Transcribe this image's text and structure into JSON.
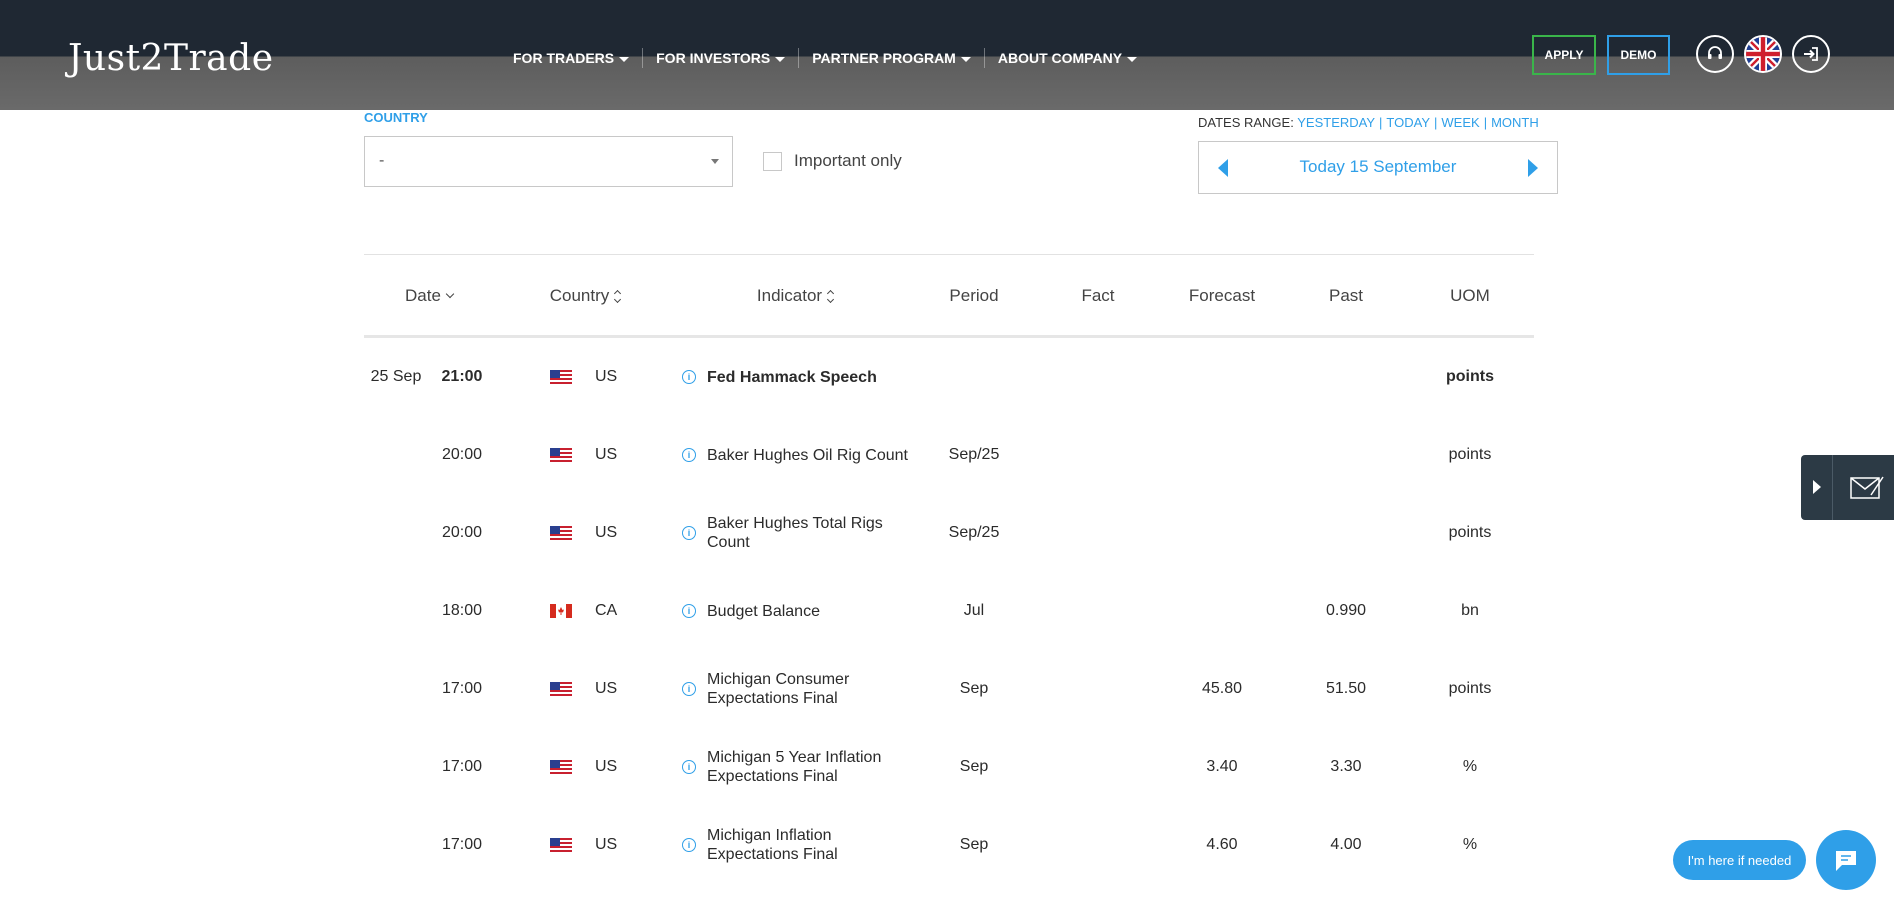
{
  "header": {
    "logo": "Just2Trade",
    "nav": [
      {
        "label": "FOR TRADERS"
      },
      {
        "label": "FOR INVESTORS"
      },
      {
        "label": "PARTNER PROGRAM"
      },
      {
        "label": "ABOUT COMPANY"
      }
    ],
    "apply_label": "APPLY",
    "demo_label": "DEMO",
    "icons": [
      "headset-icon",
      "uk-flag-icon",
      "login-icon"
    ]
  },
  "filters": {
    "country_label": "COUNTRY",
    "country_value": "-",
    "important_label": "Important only",
    "dates_range_label": "DATES RANGE:",
    "ranges": [
      "YESTERDAY",
      "TODAY",
      "WEEK",
      "MONTH"
    ],
    "current_date": "Today 15 September"
  },
  "table": {
    "headers": {
      "date": "Date",
      "country": "Country",
      "indicator": "Indicator",
      "period": "Period",
      "fact": "Fact",
      "forecast": "Forecast",
      "past": "Past",
      "uom": "UOM"
    },
    "rows": [
      {
        "day": "25 Sep",
        "time": "21:00",
        "flag": "us",
        "country": "US",
        "indicator": "Fed Hammack Speech",
        "period": "",
        "fact": "",
        "forecast": "",
        "past": "",
        "uom": "points",
        "bold": true
      },
      {
        "day": "",
        "time": "20:00",
        "flag": "us",
        "country": "US",
        "indicator": "Baker Hughes Oil Rig Count",
        "period": "Sep/25",
        "fact": "",
        "forecast": "",
        "past": "",
        "uom": "points",
        "bold": false
      },
      {
        "day": "",
        "time": "20:00",
        "flag": "us",
        "country": "US",
        "indicator": "Baker Hughes Total Rigs Count",
        "period": "Sep/25",
        "fact": "",
        "forecast": "",
        "past": "",
        "uom": "points",
        "bold": false
      },
      {
        "day": "",
        "time": "18:00",
        "flag": "ca",
        "country": "CA",
        "indicator": "Budget Balance",
        "period": "Jul",
        "fact": "",
        "forecast": "",
        "past": "0.990",
        "uom": "bn",
        "bold": false
      },
      {
        "day": "",
        "time": "17:00",
        "flag": "us",
        "country": "US",
        "indicator": "Michigan Consumer Expectations Final",
        "period": "Sep",
        "fact": "",
        "forecast": "45.80",
        "past": "51.50",
        "uom": "points",
        "bold": false
      },
      {
        "day": "",
        "time": "17:00",
        "flag": "us",
        "country": "US",
        "indicator": "Michigan 5 Year Inflation Expectations Final",
        "period": "Sep",
        "fact": "",
        "forecast": "3.40",
        "past": "3.30",
        "uom": "%",
        "bold": false
      },
      {
        "day": "",
        "time": "17:00",
        "flag": "us",
        "country": "US",
        "indicator": "Michigan Inflation Expectations Final",
        "period": "Sep",
        "fact": "",
        "forecast": "4.60",
        "past": "4.00",
        "uom": "%",
        "bold": false
      }
    ]
  },
  "chat": {
    "bubble_text": "I'm here if needed"
  },
  "colors": {
    "accent": "#2f9fe8",
    "apply_border": "#3ab54a",
    "header_dark": "#1f2833"
  }
}
